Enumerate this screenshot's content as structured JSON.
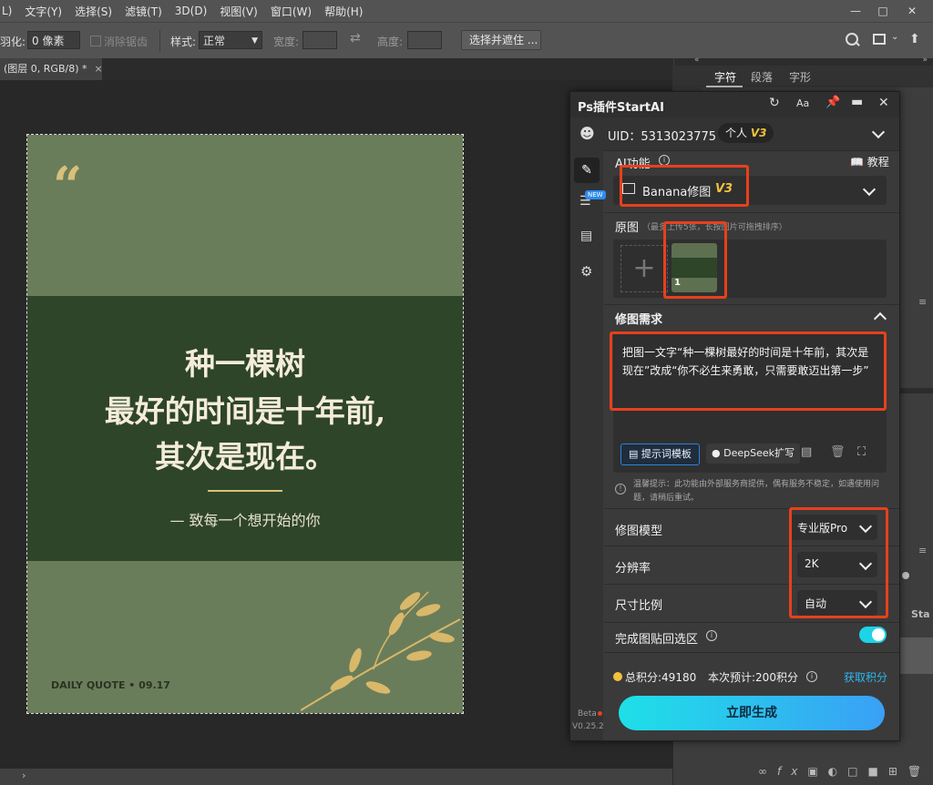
{
  "menu": {
    "items": [
      "L)",
      "文字(Y)",
      "选择(S)",
      "滤镜(T)",
      "3D(D)",
      "视图(V)",
      "窗口(W)",
      "帮助(H)"
    ]
  },
  "options": {
    "feather_label": "羽化:",
    "feather_value": "0 像素",
    "antialias_label": "消除锯齿",
    "style_label": "样式:",
    "style_value": "正常",
    "width_label": "宽度:",
    "height_label": "高度:",
    "select_mask_button": "选择并遮住 ..."
  },
  "document": {
    "tab_title": "(图层 0, RGB/8) *"
  },
  "poster": {
    "line1": "种一棵树",
    "line2": "最好的时间是十年前,",
    "line3": "其次是现在。",
    "byline": "— 致每一个想开始的你",
    "footer": "DAILY QUOTE • 09.17"
  },
  "right_panel": {
    "tabs": [
      "字符",
      "段落",
      "字形"
    ],
    "partial_label": "Sta"
  },
  "plugin": {
    "title": "Ps插件StartAI",
    "uid": "UID：5313023775",
    "plan_label": "个人",
    "plan_version": "V3",
    "new_badge": "NEW",
    "ai_function_label": "AI功能",
    "tutorial_label": "教程",
    "ai_mode_label": "Banana修图",
    "ai_mode_version": "V3",
    "source_label": "原图",
    "source_hint": "（最多上传5张，长按图片可拖拽排序）",
    "thumb_index": "1",
    "request_label": "修图需求",
    "request_text": "把图一文字“种一棵树最好的时间是十年前，其次是现在”改成“你不必生来勇敢，只需要敢迈出第一步”",
    "prompt_template_button": "提示词模板",
    "deepseek_button": "DeepSeek扩写",
    "notice": "温馨提示：此功能由外部服务商提供，偶有服务不稳定，如遇使用问题，请稍后重试。",
    "model_label": "修图模型",
    "model_value": "专业版Pro",
    "resolution_label": "分辨率",
    "resolution_value": "2K",
    "ratio_label": "尺寸比例",
    "ratio_value": "自动",
    "paste_back_label": "完成图贴回选区",
    "paste_back_enabled": true,
    "points_text": "总积分:49180",
    "estimate_text": "本次预计:200积分",
    "get_points_link": "获取积分",
    "generate_button": "立即生成",
    "beta_label": "Beta",
    "version_label": "V0.25.2"
  },
  "colors": {
    "accent_cyan": "#1fd3e6",
    "highlight_red": "#e8401c",
    "gold": "#f2c23c",
    "poster_green": "#6a7d5a",
    "poster_band": "#2e4529"
  }
}
